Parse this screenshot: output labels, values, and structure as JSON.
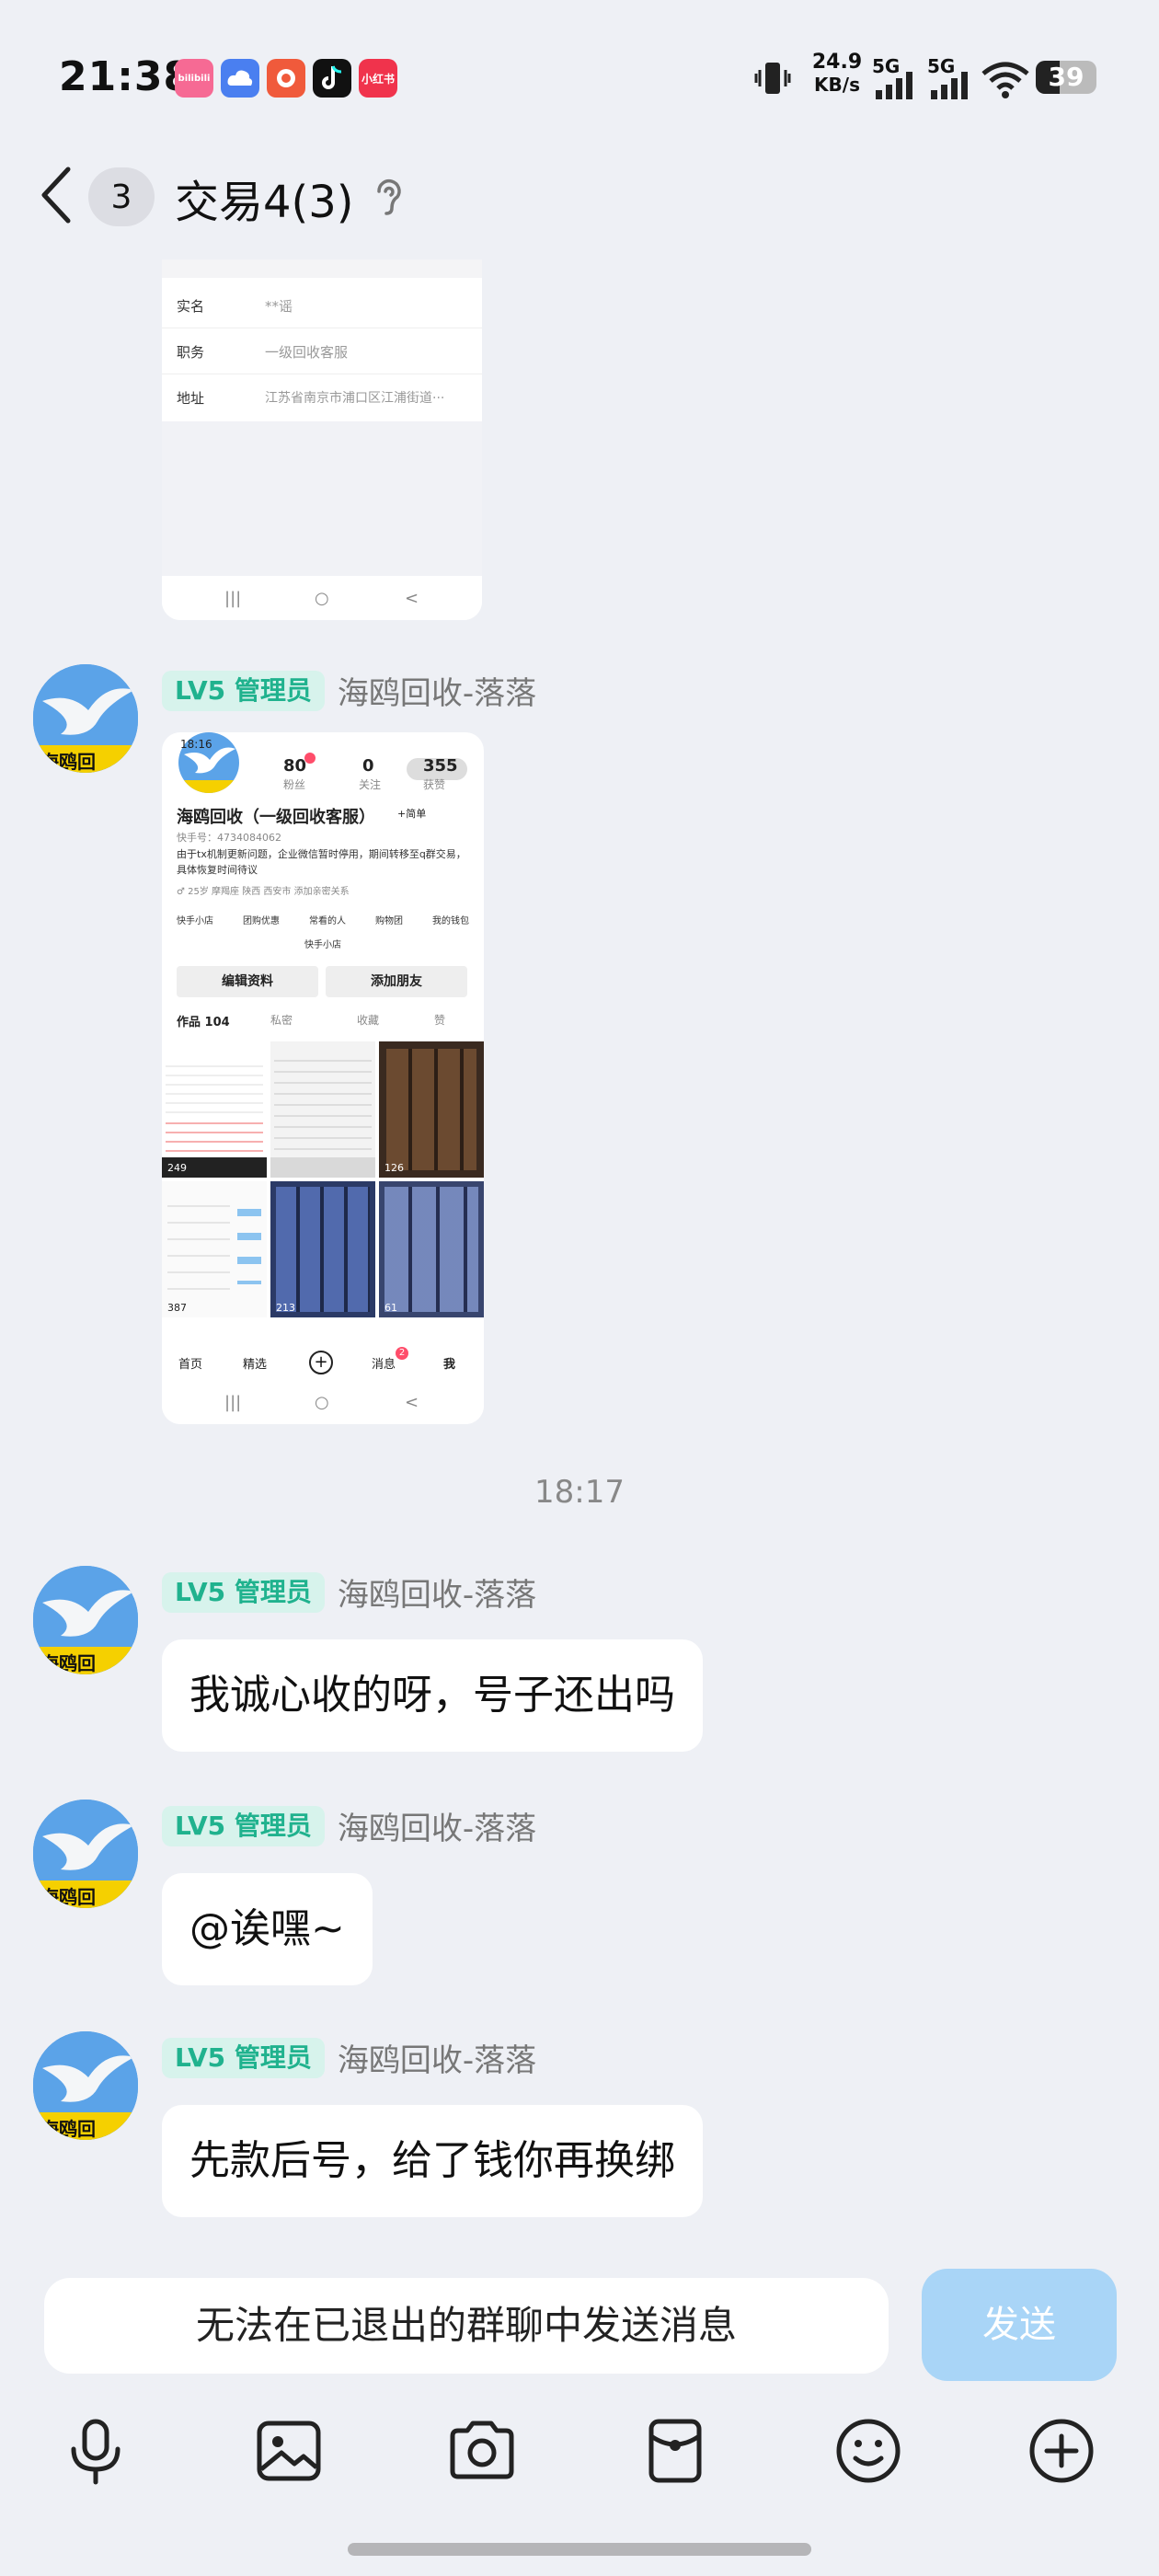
{
  "status": {
    "time": "21:38",
    "app_icons": [
      {
        "name": "bilibili-icon",
        "label": "bilibili",
        "color": "#f66a94"
      },
      {
        "name": "cloud-app-icon",
        "label": "",
        "color": "#4a7ff0"
      },
      {
        "name": "red-app-icon",
        "label": "",
        "color": "#f05a3b"
      },
      {
        "name": "tiktok-icon",
        "label": "",
        "color": "#111111"
      },
      {
        "name": "xiaohongshu-icon",
        "label": "小红书",
        "color": "#f0334c"
      }
    ],
    "net_speed": "24.9",
    "net_unit": "KB/s",
    "sim1": "5G",
    "sim2": "5G",
    "battery": "39",
    "battery_level": 0.39
  },
  "header": {
    "unread_count": "3",
    "title": "交易4(3)"
  },
  "screenshot1": {
    "rows": [
      {
        "label": "实名",
        "value": "**谣"
      },
      {
        "label": "职务",
        "value": "一级回收客服"
      },
      {
        "label": "地址",
        "value": "江苏省南京市浦口区江浦街道···"
      }
    ]
  },
  "screenshot2": {
    "time": "18:16",
    "followers": "80",
    "followers_label": "粉丝",
    "following": "0",
    "following_label": "关注",
    "likes": "355",
    "likes_label": "获赞",
    "profile_name": "海鸥回收（一级回收客服）",
    "follow_btn": "+简单",
    "account_id": "快手号：4734084062",
    "bio": "由于tx机制更新问题，企业微信暂时停用，期间转移至q群交易，具体恢复时间待议",
    "tags": "♂ 25岁 摩羯座   陕西 西安市   添加亲密关系",
    "shortcuts": [
      "快手小店",
      "团购优惠",
      "常看的人",
      "购物团",
      "我的钱包"
    ],
    "edit_btn": "编辑资料",
    "add_friend_btn": "添加朋友",
    "tabs": [
      "作品 104",
      "私密",
      "收藏",
      "赞"
    ],
    "view_counts": [
      "249",
      "126",
      "387",
      "213",
      "61"
    ],
    "bottom_nav": [
      "首页",
      "精选",
      "消息",
      "我"
    ],
    "msg_badge": "2"
  },
  "messages": [
    {
      "tag": "LV5 管理员",
      "sender": "海鸥回收-落落"
    },
    {
      "tag": "LV5 管理员",
      "sender": "海鸥回收-落落",
      "text": "我诚心收的呀，号子还出吗"
    },
    {
      "tag": "LV5 管理员",
      "sender": "海鸥回收-落落",
      "text": "@诶嘿~"
    },
    {
      "tag": "LV5 管理员",
      "sender": "海鸥回收-落落",
      "text": "先款后号，给了钱你再换绑"
    }
  ],
  "time_separator": "18:17",
  "avatar_banner_text": "海鸥回",
  "input": {
    "placeholder": "无法在已退出的群聊中发送消息",
    "send_label": "发送"
  },
  "toolbar": [
    "microphone-icon",
    "image-icon",
    "camera-icon",
    "red-packet-icon",
    "emoji-icon",
    "plus-icon"
  ]
}
